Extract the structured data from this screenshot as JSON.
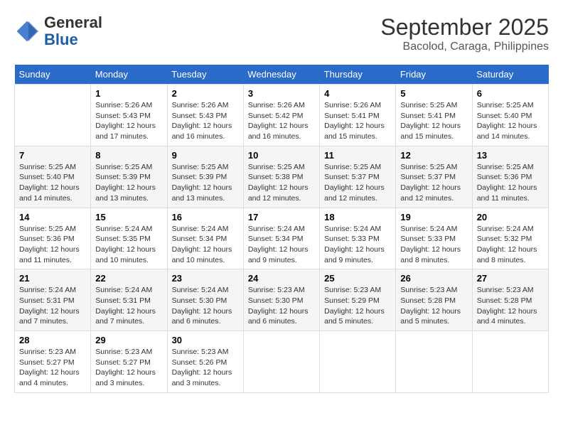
{
  "logo": {
    "general": "General",
    "blue": "Blue"
  },
  "title": "September 2025",
  "subtitle": "Bacolod, Caraga, Philippines",
  "days_header": [
    "Sunday",
    "Monday",
    "Tuesday",
    "Wednesday",
    "Thursday",
    "Friday",
    "Saturday"
  ],
  "weeks": [
    [
      {
        "day": "",
        "info": ""
      },
      {
        "day": "1",
        "info": "Sunrise: 5:26 AM\nSunset: 5:43 PM\nDaylight: 12 hours\nand 17 minutes."
      },
      {
        "day": "2",
        "info": "Sunrise: 5:26 AM\nSunset: 5:43 PM\nDaylight: 12 hours\nand 16 minutes."
      },
      {
        "day": "3",
        "info": "Sunrise: 5:26 AM\nSunset: 5:42 PM\nDaylight: 12 hours\nand 16 minutes."
      },
      {
        "day": "4",
        "info": "Sunrise: 5:26 AM\nSunset: 5:41 PM\nDaylight: 12 hours\nand 15 minutes."
      },
      {
        "day": "5",
        "info": "Sunrise: 5:25 AM\nSunset: 5:41 PM\nDaylight: 12 hours\nand 15 minutes."
      },
      {
        "day": "6",
        "info": "Sunrise: 5:25 AM\nSunset: 5:40 PM\nDaylight: 12 hours\nand 14 minutes."
      }
    ],
    [
      {
        "day": "7",
        "info": "Sunrise: 5:25 AM\nSunset: 5:40 PM\nDaylight: 12 hours\nand 14 minutes."
      },
      {
        "day": "8",
        "info": "Sunrise: 5:25 AM\nSunset: 5:39 PM\nDaylight: 12 hours\nand 13 minutes."
      },
      {
        "day": "9",
        "info": "Sunrise: 5:25 AM\nSunset: 5:39 PM\nDaylight: 12 hours\nand 13 minutes."
      },
      {
        "day": "10",
        "info": "Sunrise: 5:25 AM\nSunset: 5:38 PM\nDaylight: 12 hours\nand 12 minutes."
      },
      {
        "day": "11",
        "info": "Sunrise: 5:25 AM\nSunset: 5:37 PM\nDaylight: 12 hours\nand 12 minutes."
      },
      {
        "day": "12",
        "info": "Sunrise: 5:25 AM\nSunset: 5:37 PM\nDaylight: 12 hours\nand 12 minutes."
      },
      {
        "day": "13",
        "info": "Sunrise: 5:25 AM\nSunset: 5:36 PM\nDaylight: 12 hours\nand 11 minutes."
      }
    ],
    [
      {
        "day": "14",
        "info": "Sunrise: 5:25 AM\nSunset: 5:36 PM\nDaylight: 12 hours\nand 11 minutes."
      },
      {
        "day": "15",
        "info": "Sunrise: 5:24 AM\nSunset: 5:35 PM\nDaylight: 12 hours\nand 10 minutes."
      },
      {
        "day": "16",
        "info": "Sunrise: 5:24 AM\nSunset: 5:34 PM\nDaylight: 12 hours\nand 10 minutes."
      },
      {
        "day": "17",
        "info": "Sunrise: 5:24 AM\nSunset: 5:34 PM\nDaylight: 12 hours\nand 9 minutes."
      },
      {
        "day": "18",
        "info": "Sunrise: 5:24 AM\nSunset: 5:33 PM\nDaylight: 12 hours\nand 9 minutes."
      },
      {
        "day": "19",
        "info": "Sunrise: 5:24 AM\nSunset: 5:33 PM\nDaylight: 12 hours\nand 8 minutes."
      },
      {
        "day": "20",
        "info": "Sunrise: 5:24 AM\nSunset: 5:32 PM\nDaylight: 12 hours\nand 8 minutes."
      }
    ],
    [
      {
        "day": "21",
        "info": "Sunrise: 5:24 AM\nSunset: 5:31 PM\nDaylight: 12 hours\nand 7 minutes."
      },
      {
        "day": "22",
        "info": "Sunrise: 5:24 AM\nSunset: 5:31 PM\nDaylight: 12 hours\nand 7 minutes."
      },
      {
        "day": "23",
        "info": "Sunrise: 5:24 AM\nSunset: 5:30 PM\nDaylight: 12 hours\nand 6 minutes."
      },
      {
        "day": "24",
        "info": "Sunrise: 5:23 AM\nSunset: 5:30 PM\nDaylight: 12 hours\nand 6 minutes."
      },
      {
        "day": "25",
        "info": "Sunrise: 5:23 AM\nSunset: 5:29 PM\nDaylight: 12 hours\nand 5 minutes."
      },
      {
        "day": "26",
        "info": "Sunrise: 5:23 AM\nSunset: 5:28 PM\nDaylight: 12 hours\nand 5 minutes."
      },
      {
        "day": "27",
        "info": "Sunrise: 5:23 AM\nSunset: 5:28 PM\nDaylight: 12 hours\nand 4 minutes."
      }
    ],
    [
      {
        "day": "28",
        "info": "Sunrise: 5:23 AM\nSunset: 5:27 PM\nDaylight: 12 hours\nand 4 minutes."
      },
      {
        "day": "29",
        "info": "Sunrise: 5:23 AM\nSunset: 5:27 PM\nDaylight: 12 hours\nand 3 minutes."
      },
      {
        "day": "30",
        "info": "Sunrise: 5:23 AM\nSunset: 5:26 PM\nDaylight: 12 hours\nand 3 minutes."
      },
      {
        "day": "",
        "info": ""
      },
      {
        "day": "",
        "info": ""
      },
      {
        "day": "",
        "info": ""
      },
      {
        "day": "",
        "info": ""
      }
    ]
  ]
}
